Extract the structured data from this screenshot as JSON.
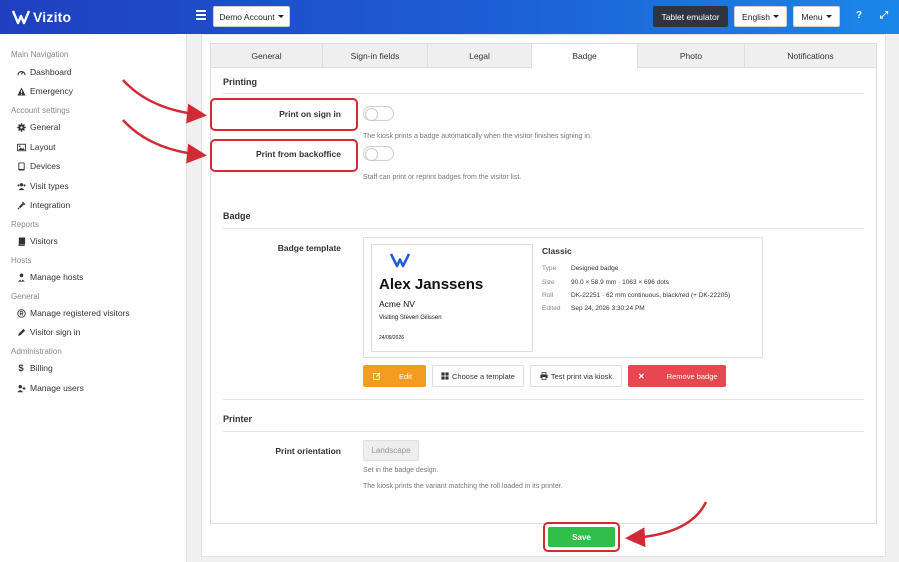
{
  "app": {
    "brand": "Vizito",
    "account_label": "Demo Account"
  },
  "topbar": {
    "tablet_label": "Tablet emulator",
    "language_label": "English",
    "menu_label": "Menu",
    "help_glyph": "?",
    "expand_glyph": "⤢"
  },
  "sidebar": {
    "sections": [
      {
        "title": "Main Navigation",
        "items": [
          {
            "label": "Dashboard",
            "icon": "dashboard-icon"
          },
          {
            "label": "Emergency",
            "icon": "warning-icon"
          }
        ]
      },
      {
        "title": "Account settings",
        "items": [
          {
            "label": "General",
            "icon": "gear-icon"
          },
          {
            "label": "Layout",
            "icon": "image-icon"
          },
          {
            "label": "Devices",
            "icon": "tablet-icon"
          },
          {
            "label": "Visit types",
            "icon": "users-icon"
          },
          {
            "label": "Integration",
            "icon": "plug-icon"
          }
        ]
      },
      {
        "title": "Reports",
        "items": [
          {
            "label": "Visitors",
            "icon": "book-icon"
          }
        ]
      },
      {
        "title": "Hosts",
        "items": [
          {
            "label": "Manage hosts",
            "icon": "user-tie-icon"
          }
        ]
      },
      {
        "title": "General",
        "items": [
          {
            "label": "Manage registered visitors",
            "icon": "registered-icon"
          },
          {
            "label": "Visitor sign in",
            "icon": "pencil-icon"
          }
        ]
      },
      {
        "title": "Administration",
        "items": [
          {
            "label": "Billing",
            "icon": "dollar-icon"
          },
          {
            "label": "Manage users",
            "icon": "user-plus-icon"
          }
        ]
      }
    ]
  },
  "tabs": [
    {
      "label": "General"
    },
    {
      "label": "Sign-in fields"
    },
    {
      "label": "Legal"
    },
    {
      "label": "Badge",
      "active": true
    },
    {
      "label": "Photo"
    },
    {
      "label": "Notifications"
    }
  ],
  "printing": {
    "title": "Printing",
    "print_on_sign_in": {
      "label": "Print on sign in",
      "help": "The kiosk prints a badge automatically when the visitor finishes signing in.",
      "enabled": false
    },
    "print_from_backoffice": {
      "label": "Print from backoffice",
      "help": "Staff can print or reprint badges from the visitor list.",
      "enabled": false
    }
  },
  "badge": {
    "title": "Badge",
    "template_label": "Badge template",
    "preview": {
      "name": "Alex Janssens",
      "company": "Acme NV",
      "visiting": "Visiting Steven Gilissen",
      "date": "24/09/2026"
    },
    "meta": {
      "name": "Classic",
      "rows": [
        {
          "key": "Type",
          "value": "Designed badge"
        },
        {
          "key": "Size",
          "value": "90.0 × 58.9 mm · 1063 × 696 dots"
        },
        {
          "key": "Roll",
          "value": "DK-22251 · 62 mm continuous, black/red (+ DK-22205)"
        },
        {
          "key": "Edited",
          "value": "Sep 24, 2026 3:30:24 PM"
        }
      ]
    },
    "actions": {
      "edit": "Edit",
      "choose": "Choose a template",
      "test": "Test print via kiosk",
      "remove": "Remove badge"
    }
  },
  "printer": {
    "title": "Printer",
    "orientation_label": "Print orientation",
    "orientation_value": "Landscape",
    "help1": "Set in the badge design.",
    "help2": "The kiosk prints the variant matching the roll loaded in its printer."
  },
  "save_label": "Save",
  "colors": {
    "accent_blue": "#1d5fd6",
    "orange": "#f39c1f",
    "red": "#e9474f",
    "green": "#2fbf4a",
    "annotation_red": "#d12a35"
  }
}
